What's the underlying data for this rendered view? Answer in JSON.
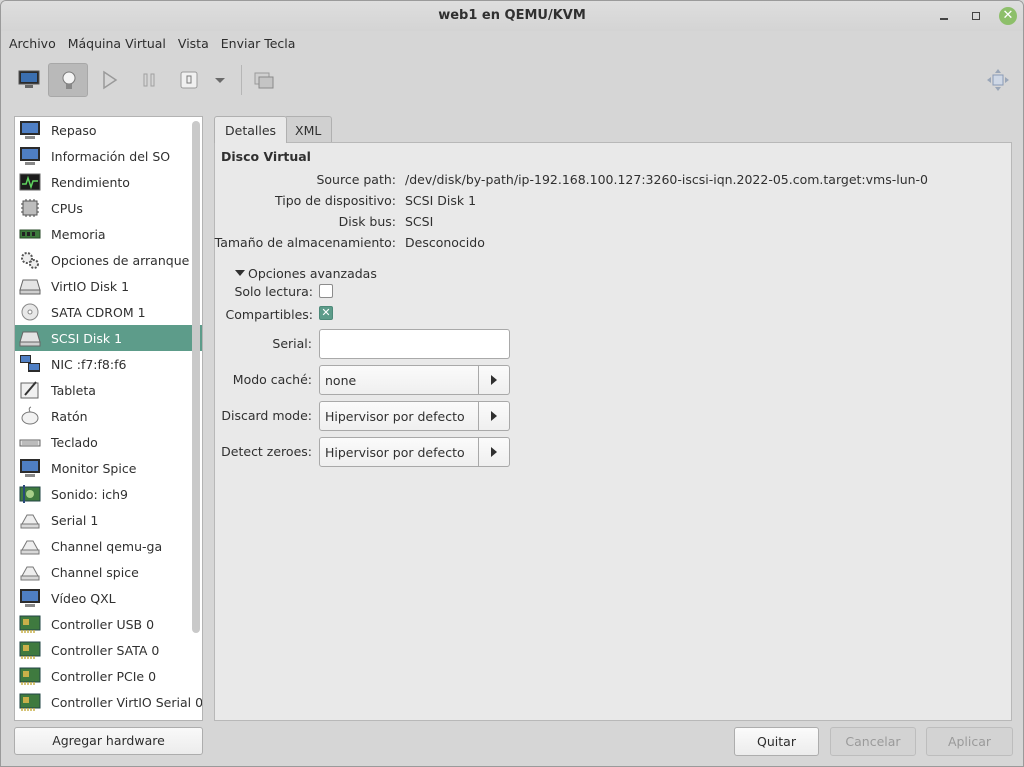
{
  "window": {
    "title": "web1 en QEMU/KVM"
  },
  "menu": [
    "Archivo",
    "Máquina Virtual",
    "Vista",
    "Enviar Tecla"
  ],
  "toolbar": {
    "buttons": [
      "console-monitor-icon",
      "lightbulb-details-icon",
      "play-icon",
      "pause-icon",
      "power-icon",
      "dropdown-arrow-icon",
      "snapshot-icon",
      "fullscreen-icon"
    ],
    "active": "lightbulb-details-icon"
  },
  "sidebar": {
    "items": [
      {
        "label": "Repaso",
        "icon": "monitor-icon"
      },
      {
        "label": "Información del SO",
        "icon": "monitor-icon"
      },
      {
        "label": "Rendimiento",
        "icon": "performance-graph-icon"
      },
      {
        "label": "CPUs",
        "icon": "cpu-chip-icon"
      },
      {
        "label": "Memoria",
        "icon": "memory-stick-icon"
      },
      {
        "label": "Opciones de arranque",
        "icon": "gears-icon"
      },
      {
        "label": "VirtIO Disk 1",
        "icon": "hard-disk-icon"
      },
      {
        "label": "SATA CDROM 1",
        "icon": "cdrom-icon"
      },
      {
        "label": "SCSI Disk 1",
        "icon": "hard-disk-icon"
      },
      {
        "label": "NIC :f7:f8:f6",
        "icon": "network-icon"
      },
      {
        "label": "Tableta",
        "icon": "tablet-icon"
      },
      {
        "label": "Ratón",
        "icon": "mouse-icon"
      },
      {
        "label": "Teclado",
        "icon": "keyboard-icon"
      },
      {
        "label": "Monitor Spice",
        "icon": "monitor-icon"
      },
      {
        "label": "Sonido: ich9",
        "icon": "sound-icon"
      },
      {
        "label": "Serial 1",
        "icon": "serial-icon"
      },
      {
        "label": "Channel qemu-ga",
        "icon": "serial-icon"
      },
      {
        "label": "Channel spice",
        "icon": "serial-icon"
      },
      {
        "label": "Vídeo QXL",
        "icon": "monitor-icon"
      },
      {
        "label": "Controller USB 0",
        "icon": "controller-card-icon"
      },
      {
        "label": "Controller SATA 0",
        "icon": "controller-card-icon"
      },
      {
        "label": "Controller PCIe 0",
        "icon": "controller-card-icon"
      },
      {
        "label": "Controller VirtIO Serial 0",
        "icon": "controller-card-icon"
      }
    ],
    "selected_index": 8,
    "add_button": "Agregar hardware"
  },
  "tabs": [
    {
      "label": "Detalles",
      "active": true
    },
    {
      "label": "XML",
      "active": false
    }
  ],
  "details": {
    "section_title": "Disco Virtual",
    "source_path_label": "Source path:",
    "source_path": "/dev/disk/by-path/ip-192.168.100.127:3260-iscsi-iqn.2022-05.com.target:vms-lun-0",
    "device_type_label": "Tipo de dispositivo:",
    "device_type": "SCSI Disk 1",
    "disk_bus_label": "Disk bus:",
    "disk_bus": "SCSI",
    "storage_size_label": "Tamaño de almacenamiento:",
    "storage_size": "Desconocido",
    "advanced_label": "Opciones avanzadas",
    "readonly_label": "Solo lectura:",
    "readonly_checked": false,
    "shareable_label": "Compartibles:",
    "shareable_checked": true,
    "serial_label": "Serial:",
    "serial_value": "",
    "cache_label": "Modo caché:",
    "cache_value": "none",
    "discard_label": "Discard mode:",
    "discard_value": "Hipervisor por defecto",
    "detect_zeroes_label": "Detect zeroes:",
    "detect_zeroes_value": "Hipervisor por defecto"
  },
  "footer": {
    "quit": "Quitar",
    "cancel": "Cancelar",
    "apply": "Aplicar"
  },
  "colors": {
    "selection": "#5d9c8a",
    "close_button": "#8dbf6a"
  }
}
